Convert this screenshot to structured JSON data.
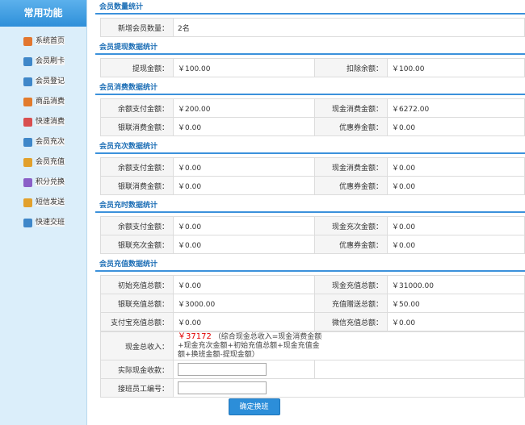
{
  "sidebar": {
    "title": "常用功能",
    "items": [
      {
        "label": "系统首页",
        "icon": "home-icon",
        "color": "#e2762f"
      },
      {
        "label": "会员刷卡",
        "icon": "member-card-icon",
        "color": "#3f87c9"
      },
      {
        "label": "会员登记",
        "icon": "member-register-icon",
        "color": "#3f87c9"
      },
      {
        "label": "商品消费",
        "icon": "cart-icon",
        "color": "#e27b2c"
      },
      {
        "label": "快速消费",
        "icon": "quick-consume-icon",
        "color": "#d84f4f"
      },
      {
        "label": "会员充次",
        "icon": "recharge-count-icon",
        "color": "#3f87c9"
      },
      {
        "label": "会员充值",
        "icon": "recharge-icon",
        "color": "#e2a02c"
      },
      {
        "label": "积分兑换",
        "icon": "points-exchange-icon",
        "color": "#8a5fc7"
      },
      {
        "label": "短信发送",
        "icon": "sms-icon",
        "color": "#e2a02c"
      },
      {
        "label": "快速交班",
        "icon": "handover-icon",
        "color": "#3f87c9"
      }
    ]
  },
  "sections": {
    "new_members": {
      "title": "会员数量统计",
      "label": "新增会员数量：",
      "value": "2名"
    },
    "withdraw": {
      "title": "会员提现数据统计",
      "withdraw_label": "提现金额：",
      "withdraw_value": "￥100.00",
      "deduct_label": "扣除余额：",
      "deduct_value": "￥100.00"
    },
    "consume": {
      "title": "会员消费数据统计",
      "rows": [
        [
          "余额支付金额：",
          "￥200.00",
          "现金消费金额：",
          "￥6272.00"
        ],
        [
          "银联消费金额：",
          "￥0.00",
          "优惠券金额：",
          "￥0.00"
        ]
      ]
    },
    "count_recharge": {
      "title": "会员充次数据统计",
      "rows": [
        [
          "余额支付金额：",
          "￥0.00",
          "现金消费金额：",
          "￥0.00"
        ],
        [
          "银联消费金额：",
          "￥0.00",
          "优惠券金额：",
          "￥0.00"
        ]
      ]
    },
    "time_recharge": {
      "title": "会员充时数据统计",
      "rows": [
        [
          "余额支付金额：",
          "￥0.00",
          "现金充次金额：",
          "￥0.00"
        ],
        [
          "银联充次金额：",
          "￥0.00",
          "优惠券金额：",
          "￥0.00"
        ]
      ]
    },
    "recharge": {
      "title": "会员充值数据统计",
      "rows": [
        [
          "初始充值总额：",
          "￥0.00",
          "现金充值总额：",
          "￥31000.00"
        ],
        [
          "银联充值总额：",
          "￥3000.00",
          "充值赠送总额：",
          "￥50.00"
        ],
        [
          "支付宝充值总额：",
          "￥0.00",
          "微信充值总额：",
          "￥0.00"
        ]
      ],
      "cash_total_label": "现金总收入：",
      "cash_total_value": "￥37172",
      "cash_total_note": "（综合现金总收入=现金消费金额+现金充次金额+初始充值总额+现金充值金额+换班金额-提现金额）",
      "actual_cash_label": "实际现金收款：",
      "actual_cash_value": "",
      "staff_no_label": "接班员工编号：",
      "staff_no_value": "",
      "confirm_button": "确定换班"
    }
  }
}
